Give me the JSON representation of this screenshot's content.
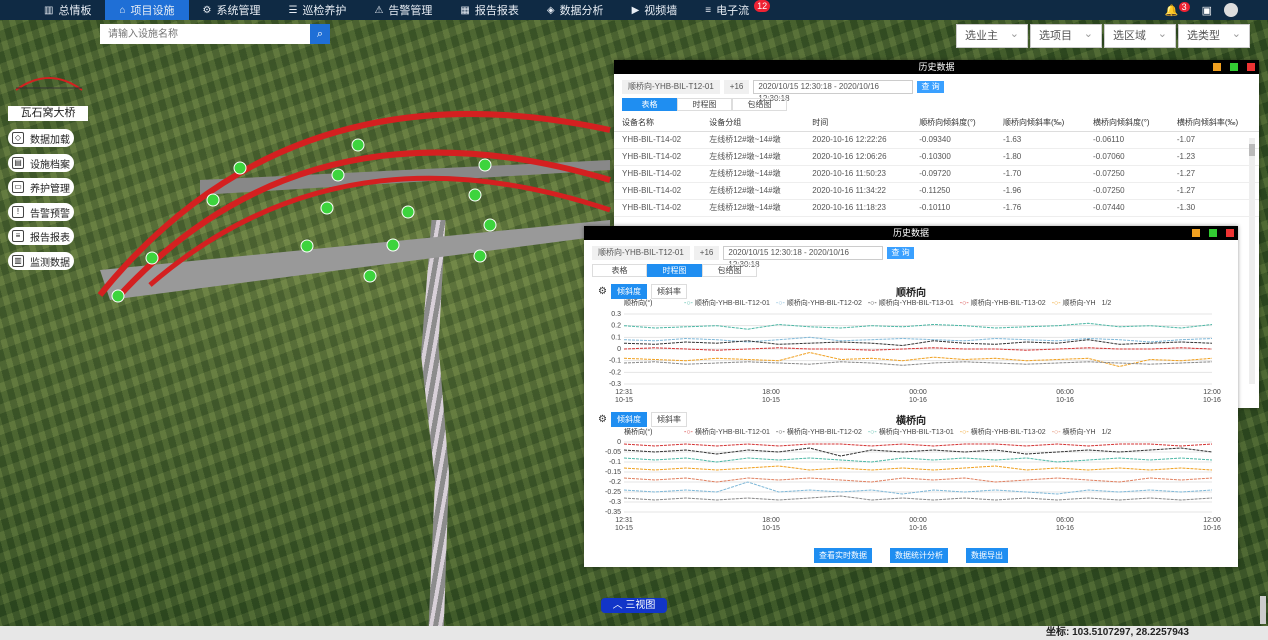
{
  "nav": {
    "items": [
      {
        "label": "总情板",
        "icon": "bar-chart-icon"
      },
      {
        "label": "项目设施",
        "icon": "home-icon"
      },
      {
        "label": "系统管理",
        "icon": "gear-icon"
      },
      {
        "label": "巡检养护",
        "icon": "clipboard-icon"
      },
      {
        "label": "告警管理",
        "icon": "alarm-icon"
      },
      {
        "label": "报告报表",
        "icon": "table-icon"
      },
      {
        "label": "数据分析",
        "icon": "shield-icon"
      },
      {
        "label": "视频墙",
        "icon": "video-icon"
      },
      {
        "label": "电子流",
        "icon": "list-icon"
      }
    ],
    "active": "项目设施",
    "dianziliu_badge": "12",
    "bell_badge": "3"
  },
  "search": {
    "placeholder": "请输入设施名称"
  },
  "filters": [
    "选业主",
    "选项目",
    "选区域",
    "选类型"
  ],
  "bridge_name": "瓦石窝大桥",
  "side_menu": [
    {
      "label": "数据加载",
      "icon": "cube-icon"
    },
    {
      "label": "设施档案",
      "icon": "archive-icon"
    },
    {
      "label": "养护管理",
      "icon": "truck-icon"
    },
    {
      "label": "告警预警",
      "icon": "warning-icon"
    },
    {
      "label": "报告报表",
      "icon": "document-icon"
    },
    {
      "label": "监测数据",
      "icon": "chart-icon"
    }
  ],
  "panel_back": {
    "title": "历史数据",
    "tag": "顺桥向-YHB-BIL-T12-01",
    "tag_count": "+16",
    "range": "2020/10/15 12:30:18 - 2020/10/16 12:30:18",
    "query": "查 询",
    "tabs": [
      "表格",
      "时程图",
      "包络图"
    ],
    "columns": [
      "设备名称",
      "设备分组",
      "时间",
      "顺桥向倾斜度(°)",
      "顺桥向倾斜率(‰)",
      "横桥向倾斜度(°)",
      "横桥向倾斜率(‰)"
    ],
    "rows": [
      [
        "YHB-BIL-T14-02",
        "左线桥12#墩~14#墩",
        "2020-10-16 12:22:26",
        "-0.09340",
        "-1.63",
        "-0.06110",
        "-1.07"
      ],
      [
        "YHB-BIL-T14-02",
        "左线桥12#墩~14#墩",
        "2020-10-16 12:06:26",
        "-0.10300",
        "-1.80",
        "-0.07060",
        "-1.23"
      ],
      [
        "YHB-BIL-T14-02",
        "左线桥12#墩~14#墩",
        "2020-10-16 11:50:23",
        "-0.09720",
        "-1.70",
        "-0.07250",
        "-1.27"
      ],
      [
        "YHB-BIL-T14-02",
        "左线桥12#墩~14#墩",
        "2020-10-16 11:34:22",
        "-0.11250",
        "-1.96",
        "-0.07250",
        "-1.27"
      ],
      [
        "YHB-BIL-T14-02",
        "左线桥12#墩~14#墩",
        "2020-10-16 11:18:23",
        "-0.10110",
        "-1.76",
        "-0.07440",
        "-1.30"
      ]
    ]
  },
  "panel_front": {
    "title": "历史数据",
    "tag": "顺桥向-YHB-BIL-T12-01",
    "tag_count": "+16",
    "range": "2020/10/15 12:30:18 - 2020/10/16 12:30:18",
    "query": "查 询",
    "tabs": [
      "表格",
      "时程图",
      "包络图"
    ],
    "sub_tabs": [
      "倾斜度",
      "倾斜率"
    ],
    "buttons": [
      "查看实时数据",
      "数据统计分析",
      "数据导出"
    ],
    "legend_page": "1/2"
  },
  "colors": {
    "red": "#d33",
    "gray": "#888",
    "teal": "#4cb7a5",
    "orange": "#f0a020",
    "dark": "#333",
    "lightblue": "#7fb8d8"
  },
  "chart_data": [
    {
      "type": "line",
      "title": "顺桥向",
      "ylabel": "顺桥向(°)",
      "ylim": [
        -0.3,
        0.3
      ],
      "yticks": [
        "0.3",
        "0.2",
        "0.1",
        "0",
        "-0.1",
        "-0.2",
        "-0.3"
      ],
      "xticks": [
        [
          "12:31",
          "10-15"
        ],
        [
          "18:00",
          "10-15"
        ],
        [
          "00:00",
          "10-16"
        ],
        [
          "06:00",
          "10-16"
        ],
        [
          "12:00",
          "10-16"
        ]
      ],
      "legend": [
        "顺桥向-YHB-BIL-T12-01",
        "顺桥向-YHB-BIL-T12-02",
        "顺桥向-YHB-BIL-T13-01",
        "顺桥向-YHB-BIL-T13-02",
        "顺桥向-YH"
      ],
      "series": [
        {
          "color": "#4cb7a5",
          "values": [
            0.2,
            0.18,
            0.19,
            0.2,
            0.17,
            0.21,
            0.19,
            0.18,
            0.2,
            0.19,
            0.21,
            0.2,
            0.18,
            0.19,
            0.2,
            0.22,
            0.19,
            0.2,
            0.18,
            0.21
          ]
        },
        {
          "color": "#7fb8d8",
          "values": [
            0.08,
            0.07,
            0.09,
            0.08,
            0.06,
            0.08,
            0.1,
            0.07,
            0.08,
            0.09,
            0.08,
            0.07,
            0.09,
            0.08,
            0.07,
            0.09,
            0.08,
            0.06,
            0.08,
            0.09
          ]
        },
        {
          "color": "#333333",
          "values": [
            0.05,
            0.04,
            0.06,
            0.05,
            0.07,
            0.04,
            0.05,
            0.06,
            0.05,
            0.03,
            0.07,
            0.05,
            0.04,
            0.06,
            0.05,
            0.08,
            0.04,
            0.05,
            0.06,
            0.05
          ]
        },
        {
          "color": "#d33333",
          "values": [
            0.0,
            0.01,
            0.0,
            -0.01,
            0.0,
            0.01,
            0.0,
            0.0,
            -0.01,
            0.0,
            0.01,
            0.0,
            0.0,
            -0.01,
            0.0,
            0.01,
            0.0,
            0.0,
            0.01,
            0.0
          ]
        },
        {
          "color": "#f0a020",
          "values": [
            -0.08,
            -0.09,
            -0.1,
            -0.08,
            -0.09,
            -0.1,
            -0.03,
            -0.09,
            -0.08,
            -0.1,
            -0.07,
            -0.09,
            -0.08,
            -0.1,
            -0.09,
            -0.08,
            -0.15,
            -0.09,
            -0.1,
            -0.08
          ]
        },
        {
          "color": "#888888",
          "values": [
            -0.12,
            -0.11,
            -0.13,
            -0.12,
            -0.11,
            -0.12,
            -0.13,
            -0.11,
            -0.12,
            -0.14,
            -0.12,
            -0.11,
            -0.12,
            -0.13,
            -0.12,
            -0.11,
            -0.12,
            -0.13,
            -0.12,
            -0.11
          ]
        }
      ]
    },
    {
      "type": "line",
      "title": "横桥向",
      "ylabel": "横桥向(°)",
      "ylim": [
        -0.35,
        0.0
      ],
      "yticks": [
        "0",
        "-0.05",
        "-0.1",
        "-0.15",
        "-0.2",
        "-0.25",
        "-0.3",
        "-0.35"
      ],
      "xticks": [
        [
          "12:31",
          "10-15"
        ],
        [
          "18:00",
          "10-15"
        ],
        [
          "00:00",
          "10-16"
        ],
        [
          "06:00",
          "10-16"
        ],
        [
          "12:00",
          "10-16"
        ]
      ],
      "legend": [
        "横桥向-YHB-BIL-T12-01",
        "横桥向-YHB-BIL-T12-02",
        "横桥向-YHB-BIL-T13-01",
        "横桥向-YHB-BIL-T13-02",
        "横桥向-YH"
      ],
      "series": [
        {
          "color": "#d33333",
          "values": [
            -0.01,
            -0.02,
            -0.01,
            -0.02,
            -0.01,
            -0.02,
            -0.01,
            -0.01,
            -0.02,
            -0.01,
            -0.02,
            -0.01,
            -0.01,
            -0.02,
            -0.01,
            -0.02,
            -0.01,
            -0.01,
            -0.02,
            -0.01
          ]
        },
        {
          "color": "#333333",
          "values": [
            -0.04,
            -0.05,
            -0.04,
            -0.06,
            -0.04,
            -0.05,
            -0.03,
            -0.07,
            -0.04,
            -0.05,
            -0.04,
            -0.05,
            -0.04,
            -0.06,
            -0.05,
            -0.04,
            -0.05,
            -0.04,
            -0.03,
            -0.05
          ]
        },
        {
          "color": "#4cb7a5",
          "values": [
            -0.08,
            -0.09,
            -0.08,
            -0.1,
            -0.08,
            -0.09,
            -0.08,
            -0.09,
            -0.1,
            -0.08,
            -0.09,
            -0.08,
            -0.09,
            -0.08,
            -0.1,
            -0.09,
            -0.08,
            -0.09,
            -0.08,
            -0.09
          ]
        },
        {
          "color": "#f0a020",
          "values": [
            -0.13,
            -0.14,
            -0.13,
            -0.14,
            -0.13,
            -0.12,
            -0.14,
            -0.13,
            -0.14,
            -0.13,
            -0.14,
            -0.13,
            -0.12,
            -0.14,
            -0.13,
            -0.14,
            -0.13,
            -0.14,
            -0.13,
            -0.14
          ]
        },
        {
          "color": "#e08060",
          "values": [
            -0.18,
            -0.19,
            -0.18,
            -0.2,
            -0.18,
            -0.19,
            -0.18,
            -0.19,
            -0.2,
            -0.18,
            -0.19,
            -0.18,
            -0.2,
            -0.19,
            -0.18,
            -0.19,
            -0.2,
            -0.18,
            -0.19,
            -0.18
          ]
        },
        {
          "color": "#7fb8d8",
          "values": [
            -0.24,
            -0.25,
            -0.24,
            -0.25,
            -0.2,
            -0.25,
            -0.24,
            -0.25,
            -0.24,
            -0.26,
            -0.24,
            -0.25,
            -0.24,
            -0.25,
            -0.26,
            -0.24,
            -0.25,
            -0.24,
            -0.25,
            -0.24
          ]
        },
        {
          "color": "#888888",
          "values": [
            -0.28,
            -0.29,
            -0.28,
            -0.29,
            -0.28,
            -0.29,
            -0.28,
            -0.27,
            -0.29,
            -0.28,
            -0.29,
            -0.28,
            -0.29,
            -0.28,
            -0.29,
            -0.28,
            -0.29,
            -0.28,
            -0.29,
            -0.28
          ]
        }
      ]
    }
  ],
  "three_view": "三视图",
  "coord_text": "坐标:  103.5107297, 28.2257943"
}
